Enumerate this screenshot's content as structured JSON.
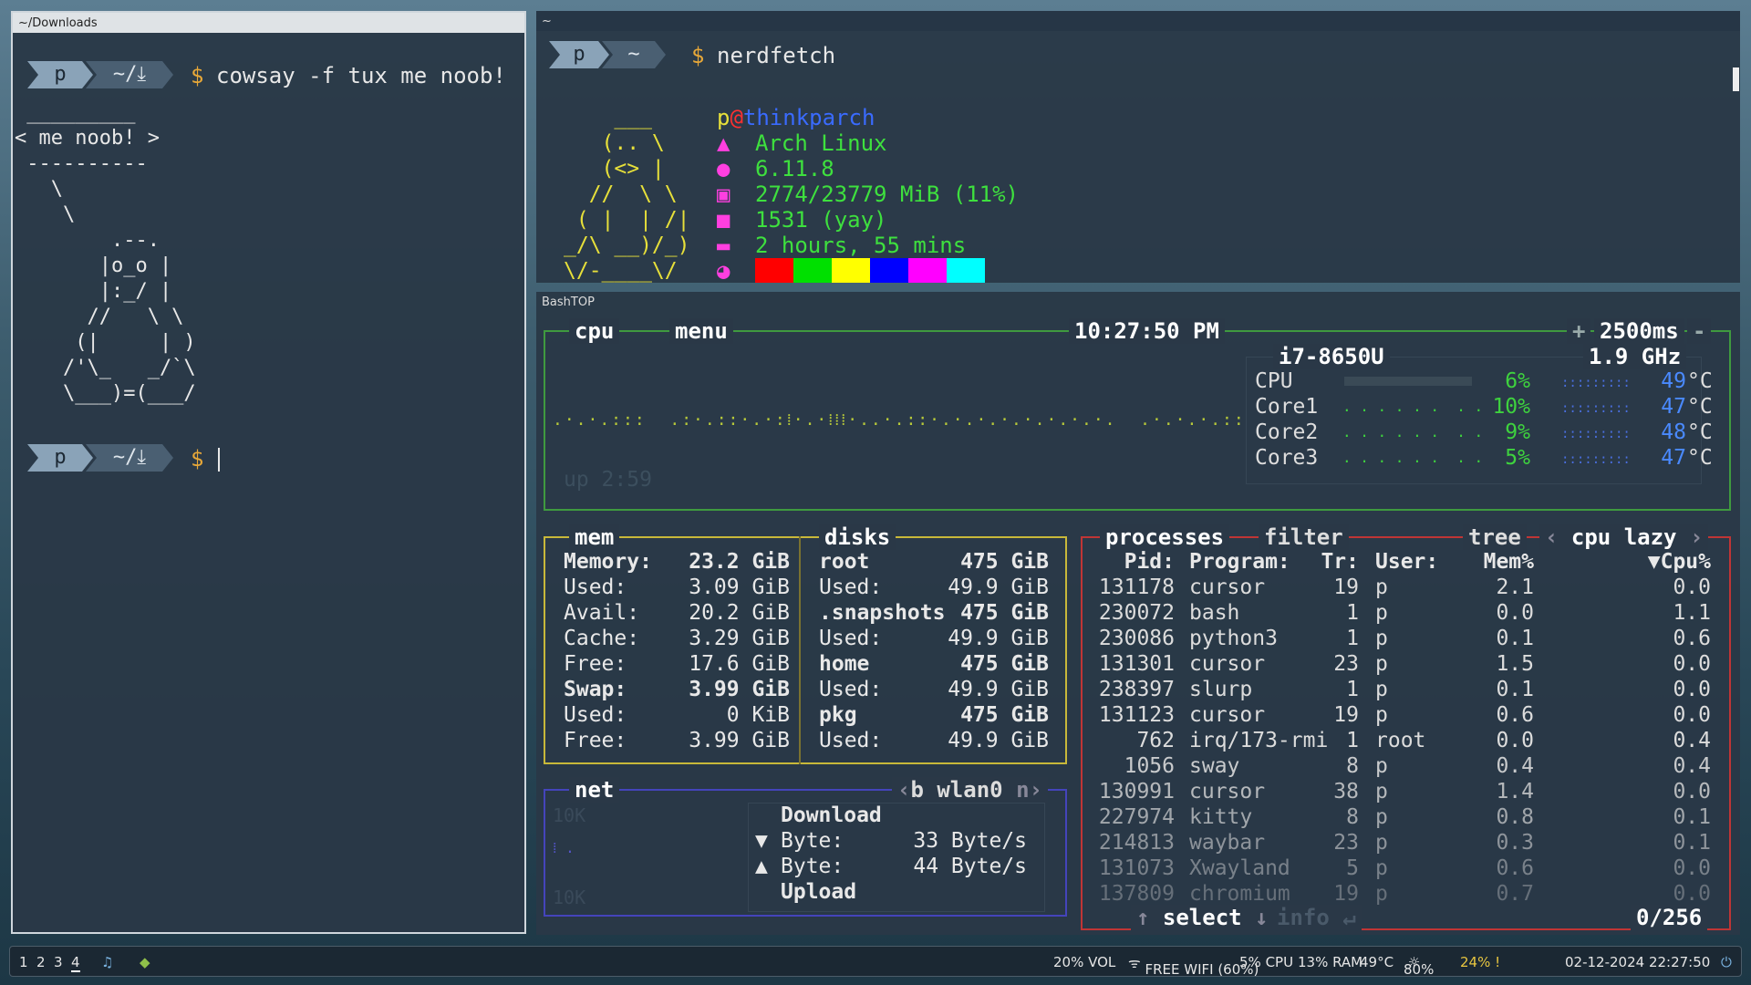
{
  "w1": {
    "title": "~/Downloads",
    "prompt_user": "p",
    "prompt_dir": "~/⤓",
    "command": "cowsay -f tux me noob!",
    "art": " _________\n< me noob! >\n ----------\n   \\\n    \\\n        .--.\n       |o_o |\n       |:_/ |\n      //   \\ \\\n     (|     | )\n    /'\\_   _/`\\\n    \\___)=(___/",
    "prompt2_user": "p",
    "prompt2_dir": "~/⤓",
    "dollar": "$"
  },
  "w2": {
    "title": "~",
    "prompt_user": "p",
    "prompt_dir": "~",
    "dollar": "$",
    "command": "nerdfetch",
    "ascii": "    ___\n   (.. \\\n   (<> |\n  //  \\ \\\n ( |  | /|\n_/\\ __)/_)\n\\/-____\\/",
    "user": "p",
    "at": "@",
    "host": "thinkparch",
    "os": "Arch Linux",
    "kernel": "6.11.8",
    "memory": "2774/23779 MiB (11%)",
    "packages": "1531 (yay)",
    "uptime": "2 hours, 55 mins",
    "colors": [
      "#ff0000",
      "#00e000",
      "#ffff00",
      "#0000ff",
      "#ff00ff",
      "#00ffff"
    ]
  },
  "w3": {
    "title": "BashTOP",
    "cpu": {
      "label": "cpu",
      "menu": "menu",
      "clock": "10:27:50 PM",
      "interval": "2500ms",
      "plus": "+",
      "minus": "-",
      "model": "i7-8650U",
      "freq": "1.9 GHz",
      "uptime": "up 2:59",
      "rows": [
        {
          "name": "CPU",
          "pct": "6%",
          "temp": "49",
          "unit": "°C"
        },
        {
          "name": "Core1",
          "pct": "10%",
          "temp": "47",
          "unit": "°C"
        },
        {
          "name": "Core2",
          "pct": "9%",
          "temp": "48",
          "unit": "°C"
        },
        {
          "name": "Core3",
          "pct": "5%",
          "temp": "47",
          "unit": "°C"
        }
      ]
    },
    "mem": {
      "label": "mem",
      "rows": [
        [
          "Memory:",
          "23.2 GiB"
        ],
        [
          "Used:",
          "3.09 GiB"
        ],
        [
          "Avail:",
          "20.2 GiB"
        ],
        [
          "Cache:",
          "3.29 GiB"
        ],
        [
          "Free:",
          "17.6 GiB"
        ],
        [
          "Swap:",
          "3.99 GiB"
        ],
        [
          "Used:",
          "0 KiB"
        ],
        [
          "Free:",
          "3.99 GiB"
        ]
      ]
    },
    "disks": {
      "label": "disks",
      "rows": [
        [
          "root",
          "475 GiB"
        ],
        [
          "Used:",
          "49.9 GiB"
        ],
        [
          ".snapshots",
          "475 GiB"
        ],
        [
          "Used:",
          "49.9 GiB"
        ],
        [
          "home",
          "475 GiB"
        ],
        [
          "Used:",
          "49.9 GiB"
        ],
        [
          "pkg",
          "475 GiB"
        ],
        [
          "Used:",
          "49.9 GiB"
        ]
      ]
    },
    "net": {
      "label": "net",
      "b": "b",
      "iface": "wlan0",
      "n": "n",
      "scale_top": "10K",
      "scale_bot": "10K",
      "download": "Download",
      "down_label": "Byte:",
      "down_val": "33 Byte/s",
      "up_label": "Byte:",
      "up_val": "44 Byte/s",
      "upload": "Upload"
    },
    "proc": {
      "label": "processes",
      "filter": "filter",
      "tree": "tree",
      "sort": "cpu lazy",
      "headers": [
        "Pid:",
        "Program:",
        "Tr:",
        "User:",
        "Mem%",
        "▼Cpu%"
      ],
      "rows": [
        [
          "131178",
          "cursor",
          "19",
          "p",
          "2.1",
          "0.0"
        ],
        [
          "230072",
          "bash",
          "1",
          "p",
          "0.0",
          "1.1"
        ],
        [
          "230086",
          "python3",
          "1",
          "p",
          "0.1",
          "0.6"
        ],
        [
          "131301",
          "cursor",
          "23",
          "p",
          "1.5",
          "0.0"
        ],
        [
          "238397",
          "slurp",
          "1",
          "p",
          "0.1",
          "0.0"
        ],
        [
          "131123",
          "cursor",
          "19",
          "p",
          "0.6",
          "0.0"
        ],
        [
          "762",
          "irq/173-rmi",
          "1",
          "root",
          "0.0",
          "0.4"
        ],
        [
          "1056",
          "sway",
          "8",
          "p",
          "0.4",
          "0.4"
        ],
        [
          "130991",
          "cursor",
          "38",
          "p",
          "1.4",
          "0.0"
        ],
        [
          "227974",
          "kitty",
          "8",
          "p",
          "0.8",
          "0.1"
        ],
        [
          "214813",
          "waybar",
          "23",
          "p",
          "0.3",
          "0.1"
        ],
        [
          "131073",
          "Xwayland",
          "5",
          "p",
          "0.6",
          "0.0"
        ],
        [
          "137809",
          "chromium",
          "19",
          "p",
          "0.7",
          "0.0"
        ]
      ],
      "select": "select",
      "info": "info",
      "count": "0/256"
    }
  },
  "bar": {
    "workspaces": [
      "1",
      "2",
      "3",
      "4"
    ],
    "vol": "20% VOL",
    "wifi": "FREE WIFI (60%)",
    "cpu": "5% CPU",
    "ram": "13% RAM",
    "temp": "49°C",
    "bright": "80%",
    "battery": "24% !",
    "datetime": "02-12-2024 22:27:50"
  }
}
